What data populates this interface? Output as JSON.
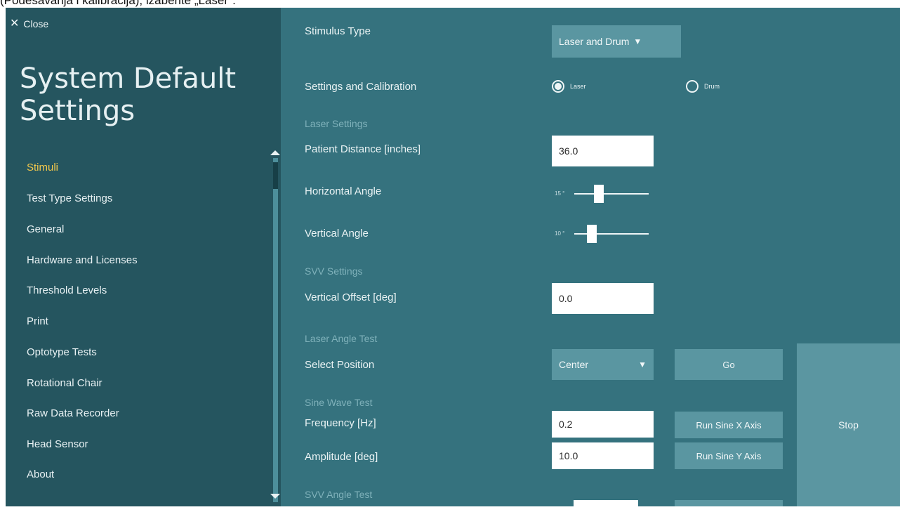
{
  "caption": "(Podešavanja i kalibracija), izaberite „Laser\".",
  "sidebar": {
    "close_label": "Close",
    "title_line1": "System Default",
    "title_line2": "Settings",
    "items": [
      {
        "label": "Stimuli",
        "active": true
      },
      {
        "label": "Test Type Settings"
      },
      {
        "label": "General"
      },
      {
        "label": "Hardware and Licenses"
      },
      {
        "label": "Threshold Levels"
      },
      {
        "label": "Print"
      },
      {
        "label": "Optotype Tests"
      },
      {
        "label": "Rotational Chair"
      },
      {
        "label": "Raw Data Recorder"
      },
      {
        "label": "Head Sensor"
      },
      {
        "label": "About"
      }
    ]
  },
  "main": {
    "stimulus_type": {
      "label": "Stimulus Type",
      "value": "Laser and Drum"
    },
    "settings_calibration": {
      "label": "Settings and Calibration",
      "options": [
        "Laser",
        "Drum"
      ],
      "selected": "Laser"
    },
    "laser_settings": {
      "heading": "Laser Settings",
      "patient_distance": {
        "label": "Patient Distance  [inches]",
        "value": "36.0"
      },
      "horizontal_angle": {
        "label": "Horizontal Angle",
        "value": "15 °"
      },
      "vertical_angle": {
        "label": "Vertical Angle",
        "value": "10 °"
      }
    },
    "svv_settings": {
      "heading": "SVV Settings",
      "vertical_offset": {
        "label": "Vertical Offset  [deg]",
        "value": "0.0"
      }
    },
    "laser_angle_test": {
      "heading": "Laser Angle Test",
      "select_position": {
        "label": "Select Position",
        "value": "Center"
      },
      "go_label": "Go"
    },
    "sine_wave_test": {
      "heading": "Sine Wave Test",
      "frequency": {
        "label": "Frequency [Hz]",
        "value": "0.2"
      },
      "amplitude": {
        "label": "Amplitude [deg]",
        "value": "10.0"
      },
      "run_x_label": "Run Sine X Axis",
      "run_y_label": "Run Sine Y Axis"
    },
    "svv_angle_test": {
      "heading": "SVV Angle Test"
    },
    "stop_label": "Stop"
  },
  "colors": {
    "sidebar_bg": "#25555f",
    "main_bg": "#35727e",
    "active_nav": "#f2c84b",
    "button_bg": "#5a96a1"
  }
}
